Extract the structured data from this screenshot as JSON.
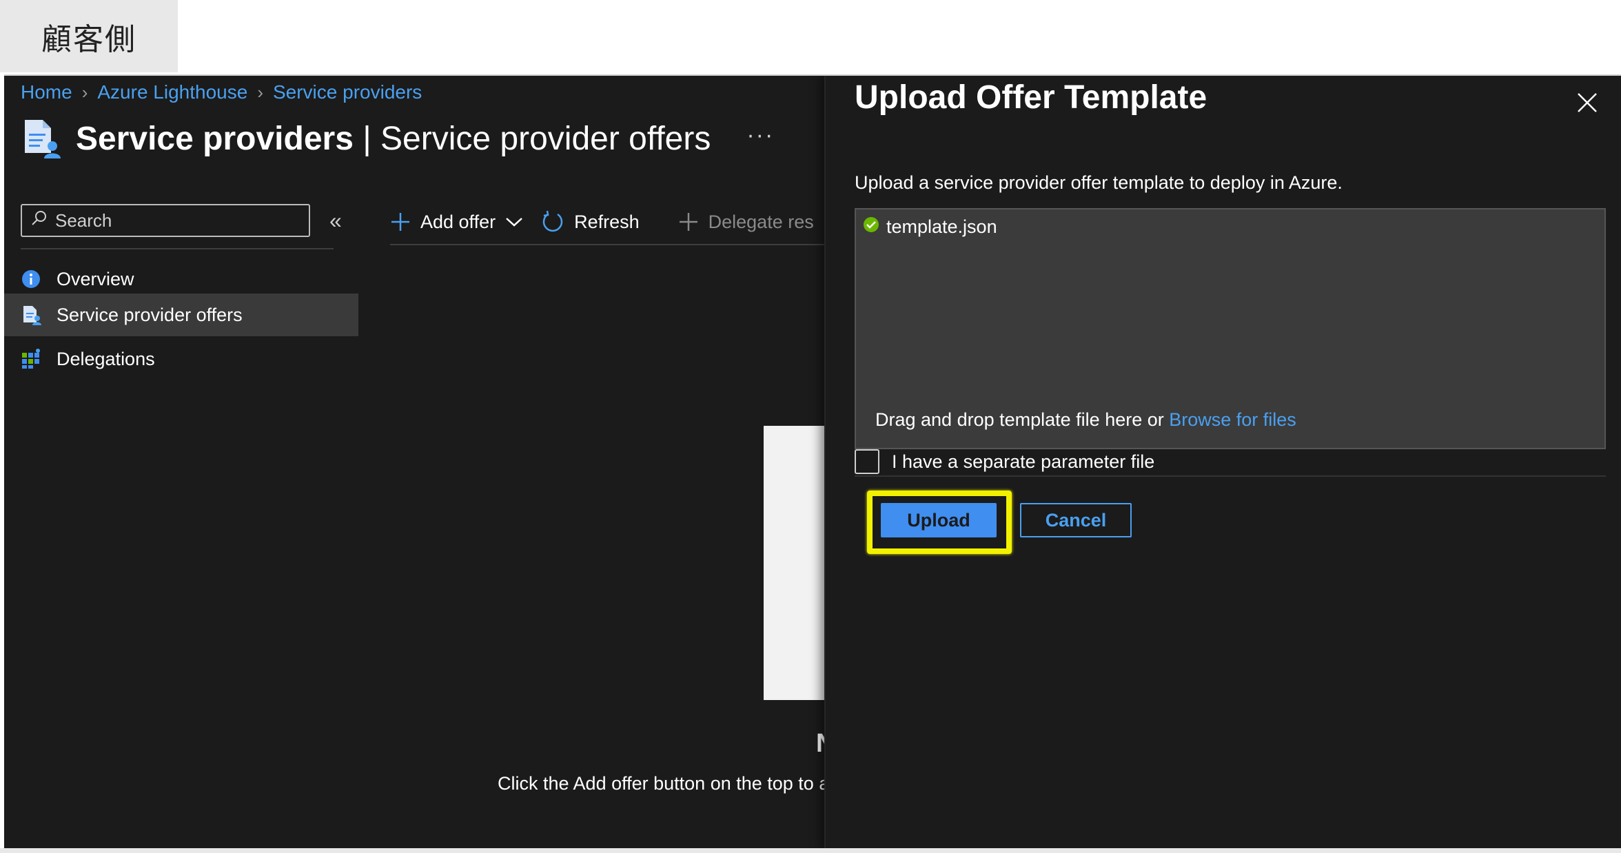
{
  "caption": "顧客側",
  "breadcrumb": {
    "items": [
      "Home",
      "Azure Lighthouse",
      "Service providers"
    ]
  },
  "page": {
    "title_bold": "Service providers",
    "title_rest": " | Service provider offers",
    "more": "···"
  },
  "search": {
    "placeholder": "Search"
  },
  "sidebar": {
    "items": [
      {
        "label": "Overview",
        "icon": "info-icon"
      },
      {
        "label": "Service provider offers",
        "icon": "offer-document-icon"
      },
      {
        "label": "Delegations",
        "icon": "grid-icon"
      }
    ]
  },
  "toolbar": {
    "add_offer": "Add offer",
    "refresh": "Refresh",
    "delegate": "Delegate res"
  },
  "empty_state": {
    "heading": "N",
    "description": "Click the Add offer button on the top to a"
  },
  "panel": {
    "title": "Upload Offer Template",
    "description": "Upload a service provider offer template to deploy in Azure.",
    "file_name": "template.json",
    "drop_text": "Drag and drop template file here",
    "or": " or ",
    "browse": "Browse for files",
    "param_label": "I have a separate parameter file",
    "upload": "Upload",
    "cancel": "Cancel"
  },
  "colors": {
    "accent": "#4aa0f0",
    "primary_button": "#3f8ef0",
    "highlight": "#f2f200",
    "success": "#6bb700"
  }
}
